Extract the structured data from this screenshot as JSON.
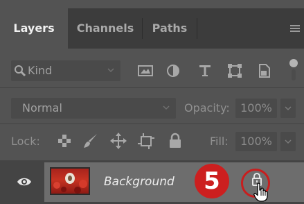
{
  "tabs": [
    {
      "label": "Layers",
      "active": true
    },
    {
      "label": "Channels",
      "active": false
    },
    {
      "label": "Paths",
      "active": false
    }
  ],
  "filter": {
    "kind_label": "Kind"
  },
  "blend": {
    "mode": "Normal",
    "opacity_label": "Opacity:",
    "opacity_value": "100%"
  },
  "lock": {
    "label": "Lock:",
    "fill_label": "Fill:",
    "fill_value": "100%"
  },
  "layer": {
    "name": "Background",
    "badge": "5",
    "visible": true,
    "locked": true
  },
  "colors": {
    "panel": "#535353",
    "tabbar": "#3c3c3c",
    "badge": "#cc1f1f",
    "highlight": "#c81e1e"
  },
  "icons": [
    "search-icon",
    "image-icon",
    "adjustment-icon",
    "type-icon",
    "shape-icon",
    "smart-object-icon",
    "lock-transparent-icon",
    "lock-pixels-icon",
    "lock-position-icon",
    "lock-artboard-icon",
    "lock-all-icon",
    "eye-icon",
    "lock-icon",
    "hand-cursor-icon"
  ]
}
